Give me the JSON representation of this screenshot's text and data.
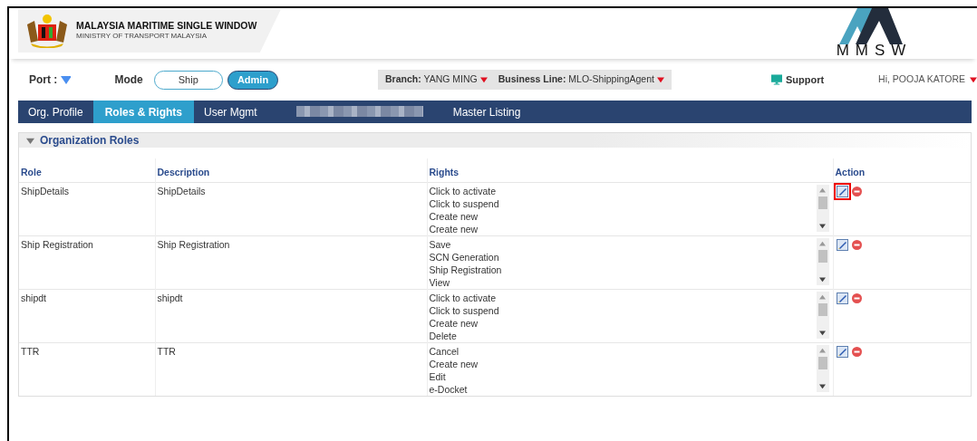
{
  "header": {
    "title": "MALAYSIA MARITIME SINGLE WINDOW",
    "subtitle": "MINISTRY OF TRANSPORT MALAYSIA",
    "logo_text": "MMSW"
  },
  "toolbar": {
    "port_label": "Port :",
    "mode_label": "Mode",
    "modes": [
      {
        "label": "Ship",
        "selected": false
      },
      {
        "label": "Admin",
        "selected": true
      }
    ],
    "branch": {
      "label": "Branch:",
      "value": "YANG MING"
    },
    "business_line": {
      "label": "Business Line:",
      "value": "MLO-ShippingAgent"
    },
    "support": "Support",
    "user": "Hi, POOJA KATORE"
  },
  "tabs": [
    {
      "kind": "text",
      "label": "Org. Profile",
      "selected": false
    },
    {
      "kind": "text",
      "label": "Roles & Rights",
      "selected": true
    },
    {
      "kind": "text",
      "label": "User Mgmt",
      "selected": false
    },
    {
      "kind": "blurred",
      "selected": false
    },
    {
      "kind": "text",
      "label": "Master Listing",
      "selected": false
    }
  ],
  "panel": {
    "title": "Organization Roles",
    "expanded": true,
    "columns": [
      "Role",
      "Description",
      "Rights",
      "Action"
    ],
    "rows": [
      {
        "role": "ShipDetails",
        "description": "ShipDetails",
        "rights": [
          "Click to activate",
          "Click to suspend",
          "Create new",
          "Create new"
        ],
        "highlighted": true
      },
      {
        "role": "Ship Registration",
        "description": "Ship Registration",
        "rights": [
          "Save",
          "SCN Generation",
          "Ship Registration",
          "View"
        ],
        "highlighted": false
      },
      {
        "role": "shipdt",
        "description": "shipdt",
        "rights": [
          "Click to activate",
          "Click to suspend",
          "Create new",
          "Delete"
        ],
        "highlighted": false
      },
      {
        "role": "TTR",
        "description": "TTR",
        "rights": [
          "Cancel",
          "Create new",
          "Edit",
          "e-Docket"
        ],
        "highlighted": false
      }
    ]
  }
}
